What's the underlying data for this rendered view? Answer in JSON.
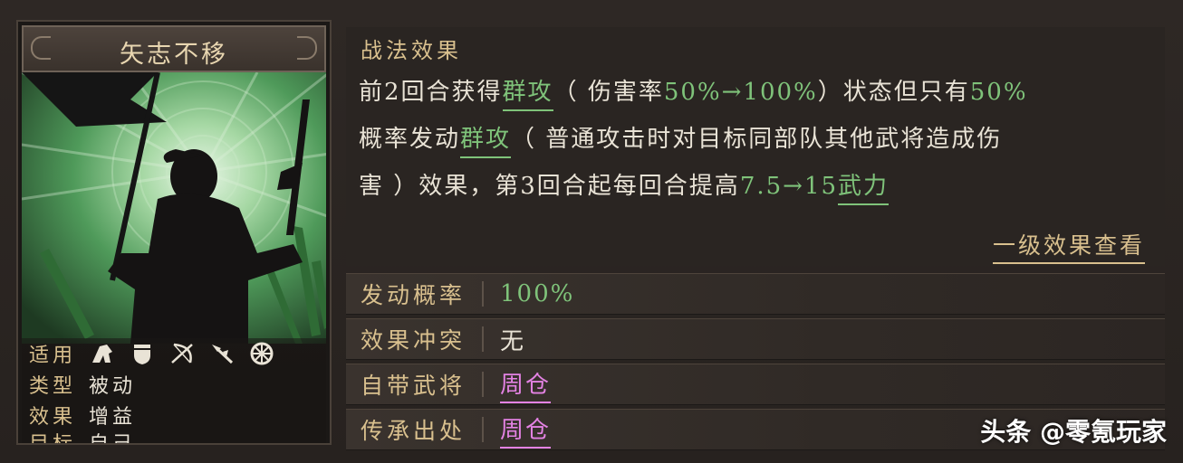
{
  "card": {
    "title": "矢志不移",
    "info": [
      {
        "key": "适用",
        "value": ""
      },
      {
        "key": "类型",
        "value": "被动"
      },
      {
        "key": "效果",
        "value": "增益"
      },
      {
        "key": "目标",
        "value": "自己"
      }
    ],
    "troop_icons": [
      "cavalry-icon",
      "shield-icon",
      "bow-icon",
      "spear-icon",
      "wheel-icon"
    ]
  },
  "effect": {
    "heading": "战法效果",
    "line1_pre": "前2回合获得",
    "link1": "群攻",
    "line1_mid": "（ 伤害率",
    "line1_val": "50%→100%",
    "line1_post": "）状态但只有",
    "line1_pct": "50%",
    "line2_pre": "概率发动",
    "link2": "群攻",
    "line2_post": "（ 普通攻击时对目标同部队其他武将造成伤",
    "line3_pre": "害 ）效果，第3回合起每回合提高",
    "line3_val": "7.5→15",
    "link3": "武力",
    "detail_link": "一级效果查看"
  },
  "attributes": [
    {
      "key": "发动概率",
      "value": "100%"
    },
    {
      "key": "效果冲突",
      "value": "无"
    },
    {
      "key": "自带武将",
      "value": "周仓"
    },
    {
      "key": "传承出处",
      "value": "周仓"
    }
  ],
  "colors": {
    "accent_gold": "#d9c08e",
    "highlight_green": "#7fc37a",
    "link_pink": "#e382e3",
    "text": "#e9e3d6"
  },
  "watermark": "头条 @零氪玩家"
}
